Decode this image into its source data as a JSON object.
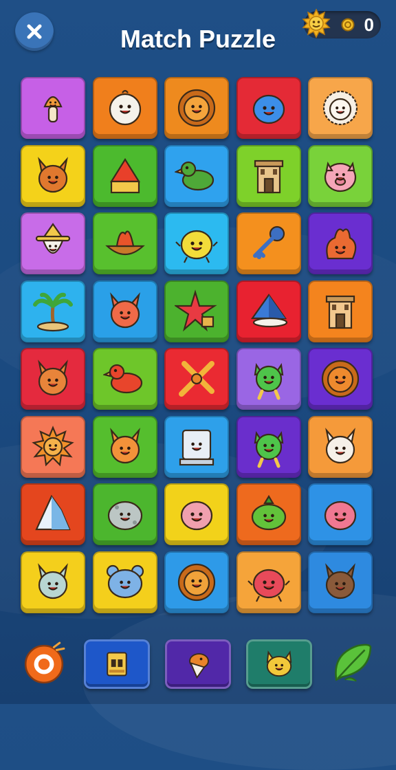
{
  "header": {
    "title": "Match Puzzle",
    "coin_count": "0",
    "icons": {
      "close": "close-icon",
      "coin": "sun-coin-icon"
    }
  },
  "board": {
    "rows": 8,
    "cols": 5,
    "tiles": [
      {
        "icon": "mushroom",
        "color": "#c660e6",
        "fg": "#f09a3a"
      },
      {
        "icon": "snowman-face",
        "color": "#f07f1c",
        "fg": "#f5f2ea"
      },
      {
        "icon": "lion",
        "color": "#ee8a1e",
        "fg": "#f4a43c"
      },
      {
        "icon": "blue-blob",
        "color": "#e42a36",
        "fg": "#3c8ee8"
      },
      {
        "icon": "sheep",
        "color": "#f7a64a",
        "fg": "#f7efe4"
      },
      {
        "icon": "fox",
        "color": "#f4d21a",
        "fg": "#e0782e"
      },
      {
        "icon": "cheese-wedge",
        "color": "#4cba2e",
        "fg": "#f2c84a"
      },
      {
        "icon": "bird",
        "color": "#2fa2ee",
        "fg": "#4ea838"
      },
      {
        "icon": "tower",
        "color": "#7ed12a",
        "fg": "#e7c48a"
      },
      {
        "icon": "pig",
        "color": "#79d23a",
        "fg": "#f5a6b8"
      },
      {
        "icon": "wizard-ghost",
        "color": "#c86ce8",
        "fg": "#f5f2ea"
      },
      {
        "icon": "fire-boat",
        "color": "#58c02e",
        "fg": "#f0a23c"
      },
      {
        "icon": "yellow-crab",
        "color": "#2cbaf0",
        "fg": "#f2dc3a"
      },
      {
        "icon": "key",
        "color": "#f4901e",
        "fg": "#3d6fc2"
      },
      {
        "icon": "fire-creature",
        "color": "#6a2ed0",
        "fg": "#ea6a32"
      },
      {
        "icon": "palm-tree",
        "color": "#2eb2ee",
        "fg": "#3fa63a"
      },
      {
        "icon": "fox-rider",
        "color": "#2aa0e8",
        "fg": "#f06a48"
      },
      {
        "icon": "starfish",
        "color": "#4cb22e",
        "fg": "#e83a42"
      },
      {
        "icon": "pyramid",
        "color": "#e82230",
        "fg": "#3a7ad6"
      },
      {
        "icon": "temple",
        "color": "#f4841e",
        "fg": "#f2c88e"
      },
      {
        "icon": "deer",
        "color": "#e42a3e",
        "fg": "#e8843a"
      },
      {
        "icon": "red-bird",
        "color": "#6ec62a",
        "fg": "#e8452c"
      },
      {
        "icon": "crossed-sticks",
        "color": "#ea2a32",
        "fg": "#f2b43a"
      },
      {
        "icon": "green-goblin",
        "color": "#9a66e4",
        "fg": "#4ec44a"
      },
      {
        "icon": "sun-lion",
        "color": "#6a2ed0",
        "fg": "#ee8a2e"
      },
      {
        "icon": "sun",
        "color": "#f57856",
        "fg": "#f0902a"
      },
      {
        "icon": "corgi",
        "color": "#55be2e",
        "fg": "#f2923a"
      },
      {
        "icon": "tv-robot",
        "color": "#2ea0ea",
        "fg": "#e8eef5"
      },
      {
        "icon": "goblin",
        "color": "#6a2ecc",
        "fg": "#4ec44a"
      },
      {
        "icon": "bunny",
        "color": "#f59a3a",
        "fg": "#f6f0e8"
      },
      {
        "icon": "iceberg",
        "color": "#e4461e",
        "fg": "#e8f2fa"
      },
      {
        "icon": "rock-face",
        "color": "#4cb62e",
        "fg": "#bcc6c4"
      },
      {
        "icon": "pink-blob",
        "color": "#f2d21a",
        "fg": "#f0a0ae"
      },
      {
        "icon": "green-turtle",
        "color": "#ee6a1e",
        "fg": "#62c23a"
      },
      {
        "icon": "pink-bug",
        "color": "#2e92e6",
        "fg": "#f07892"
      },
      {
        "icon": "fish-cat",
        "color": "#f4cf1c",
        "fg": "#b8d6d2"
      },
      {
        "icon": "blue-bear",
        "color": "#f4cf1c",
        "fg": "#7eb2e6"
      },
      {
        "icon": "lion-cub",
        "color": "#2e9ae8",
        "fg": "#f0a23a"
      },
      {
        "icon": "red-crab",
        "color": "#f5a43a",
        "fg": "#e84a5a"
      },
      {
        "icon": "wolf",
        "color": "#2e8ae0",
        "fg": "#8a5a3a"
      }
    ]
  },
  "powerups": [
    {
      "name": "bomb-powerup",
      "icon": "orange-orb-icon"
    },
    {
      "name": "shuffle-powerup",
      "icon": "card-box-icon",
      "color": "#1e57c9"
    },
    {
      "name": "hint-powerup",
      "icon": "bird-hint-icon",
      "color": "#5128a8"
    },
    {
      "name": "cat-powerup",
      "icon": "yellow-cat-icon",
      "color": "#1f7d6a"
    },
    {
      "name": "leaf-powerup",
      "icon": "leaf-icon"
    }
  ]
}
